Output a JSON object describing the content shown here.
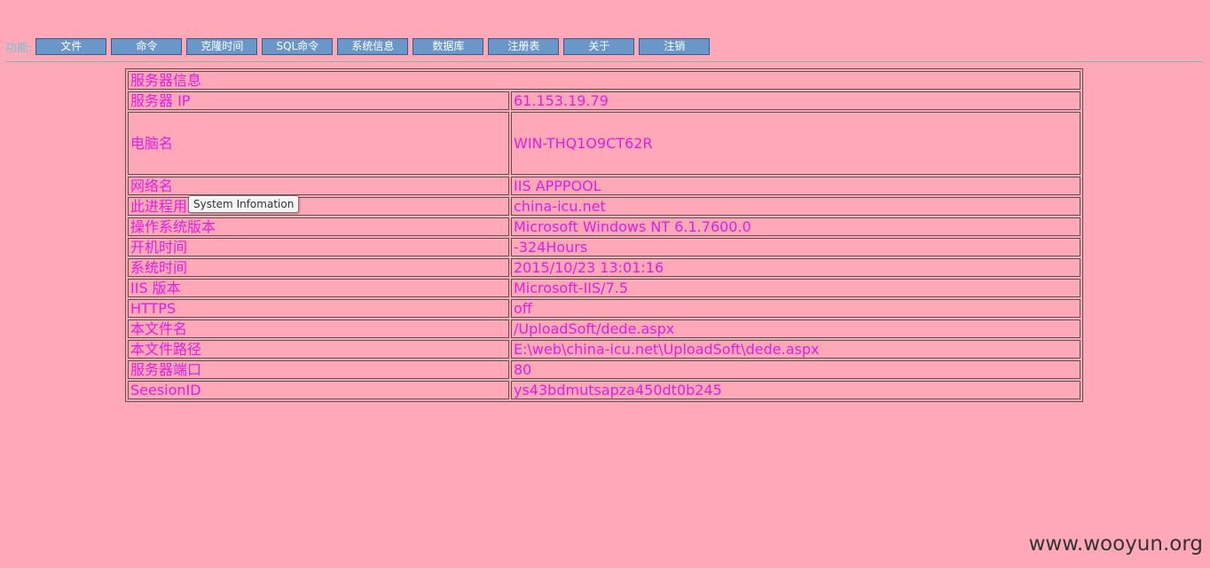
{
  "toolbar": {
    "label": "功能:",
    "buttons": [
      "文件",
      "命令",
      "克隆时间",
      "SQL命令",
      "系统信息",
      "数据库",
      "注册表",
      "关于",
      "注销"
    ]
  },
  "table": {
    "header": "服务器信息",
    "rows": [
      {
        "key": "服务器 IP",
        "value": "61.153.19.79"
      },
      {
        "key": "电脑名",
        "value": "WIN-THQ1O9CT62R"
      },
      {
        "key": "网络名",
        "value": "IIS APPPOOL"
      },
      {
        "key": "此进程用户名",
        "value": "china-icu.net"
      },
      {
        "key": "操作系统版本",
        "value": "Microsoft Windows NT 6.1.7600.0"
      },
      {
        "key": "开机时间",
        "value": "-324Hours"
      },
      {
        "key": "系统时间",
        "value": "2015/10/23 13:01:16"
      },
      {
        "key": "IIS 版本",
        "value": "Microsoft-IIS/7.5"
      },
      {
        "key": "HTTPS",
        "value": "off"
      },
      {
        "key": "本文件名",
        "value": "/UploadSoft/dede.aspx"
      },
      {
        "key": "本文件路径",
        "value": "E:\\web\\china-icu.net\\UploadSoft\\dede.aspx"
      },
      {
        "key": "服务器端口",
        "value": "80"
      },
      {
        "key": "SeesionID",
        "value": "ys43bdmutsapza450dt0b245"
      }
    ]
  },
  "tooltip": "System Infomation",
  "watermark": "www.wooyun.org"
}
